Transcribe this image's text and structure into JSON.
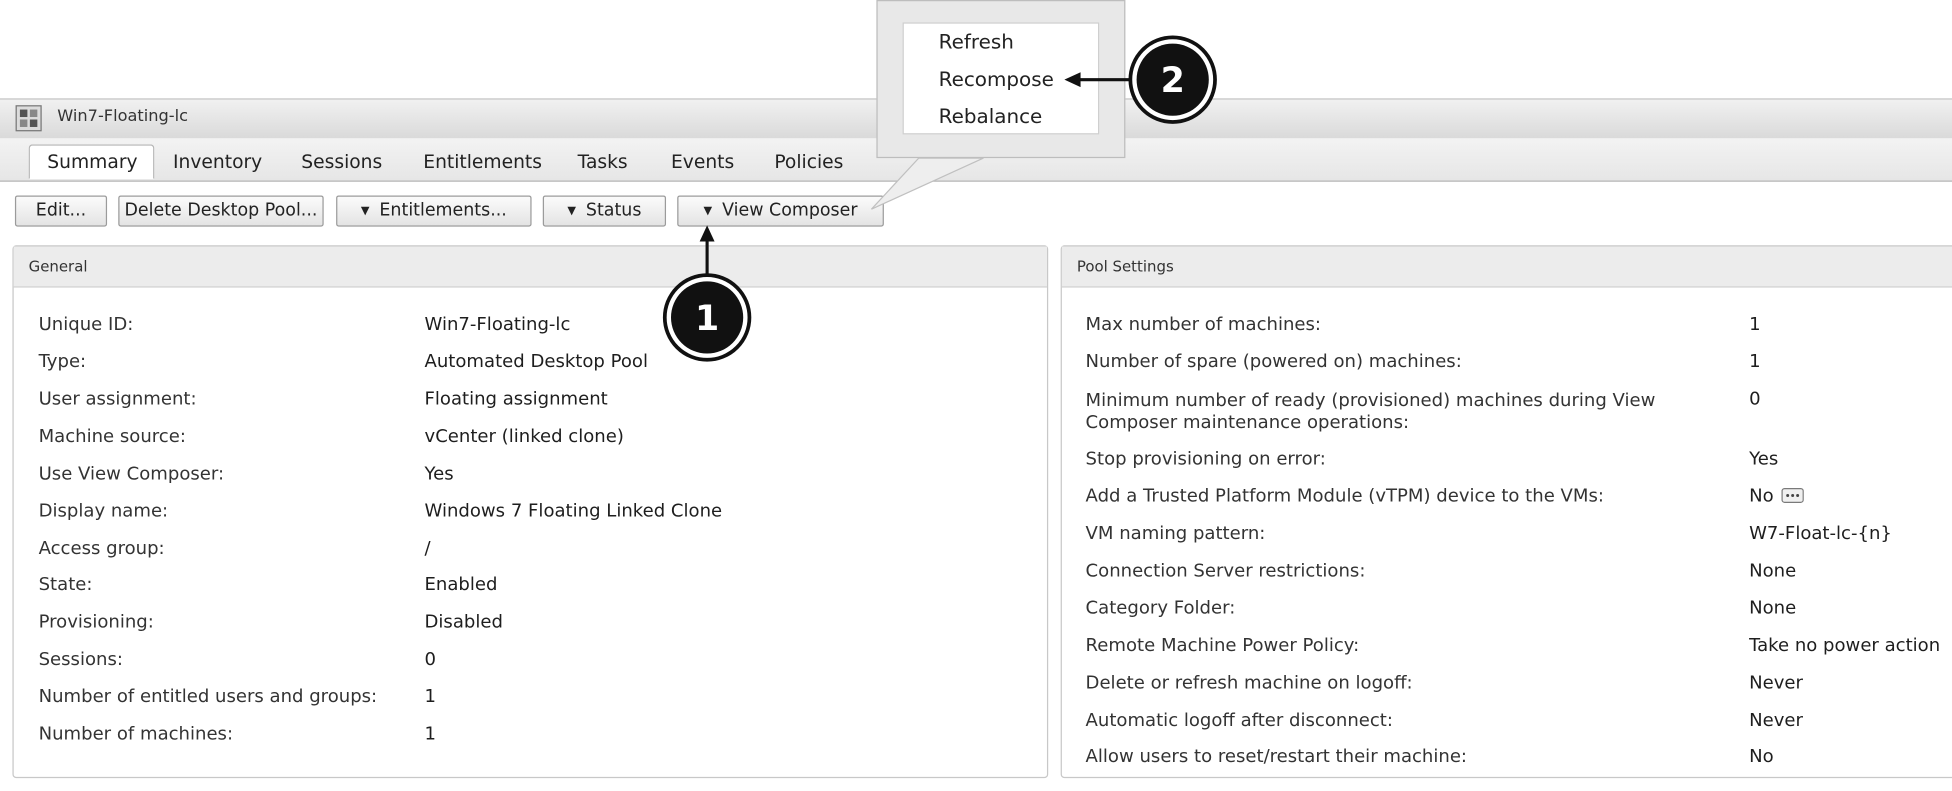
{
  "window": {
    "title": "Win7-Floating-lc"
  },
  "tabs": [
    {
      "label": "Summary",
      "active": true
    },
    {
      "label": "Inventory"
    },
    {
      "label": "Sessions"
    },
    {
      "label": "Entitlements"
    },
    {
      "label": "Tasks"
    },
    {
      "label": "Events"
    },
    {
      "label": "Policies"
    }
  ],
  "toolbar": {
    "edit": "Edit...",
    "delete_pool": "Delete Desktop Pool...",
    "entitlements": "Entitlements...",
    "status": "Status",
    "view_composer": "View Composer"
  },
  "view_composer_menu": {
    "items": [
      "Refresh",
      "Recompose",
      "Rebalance"
    ]
  },
  "callouts": {
    "one": "1",
    "two": "2"
  },
  "general": {
    "header": "General",
    "rows": [
      {
        "label": "Unique ID:",
        "value": "Win7-Floating-lc"
      },
      {
        "label": "Type:",
        "value": "Automated Desktop Pool"
      },
      {
        "label": "User assignment:",
        "value": "Floating assignment"
      },
      {
        "label": "Machine source:",
        "value": "vCenter (linked clone)"
      },
      {
        "label": "Use View Composer:",
        "value": "Yes"
      },
      {
        "label": "Display name:",
        "value": "Windows 7 Floating Linked Clone"
      },
      {
        "label": "Access group:",
        "value": "/"
      },
      {
        "label": "State:",
        "value": "Enabled"
      },
      {
        "label": "Provisioning:",
        "value": "Disabled"
      },
      {
        "label": "Sessions:",
        "value": "0"
      },
      {
        "label": "Number of entitled users and groups:",
        "value": "1"
      },
      {
        "label": "Number of machines:",
        "value": "1"
      }
    ]
  },
  "pool_settings": {
    "header": "Pool Settings",
    "rows": [
      {
        "label": "Max number of machines:",
        "value": "1"
      },
      {
        "label": "Number of spare (powered on) machines:",
        "value": "1"
      },
      {
        "label": "Minimum number of ready (provisioned) machines during View",
        "label2": "Composer maintenance operations:",
        "value": "0"
      },
      {
        "label": "Stop provisioning on error:",
        "value": "Yes"
      },
      {
        "label": "Add a Trusted Platform Module (vTPM) device to the VMs:",
        "value": "No"
      },
      {
        "label": "VM naming pattern:",
        "value": "W7-Float-lc-{n}"
      },
      {
        "label": "Connection Server restrictions:",
        "value": "None"
      },
      {
        "label": "Category Folder:",
        "value": "None"
      },
      {
        "label": "Remote Machine Power Policy:",
        "value": "Take no power action"
      },
      {
        "label": "Delete or refresh machine on logoff:",
        "value": "Never"
      },
      {
        "label": "Automatic logoff after disconnect:",
        "value": "Never"
      },
      {
        "label": "Allow users to reset/restart their machine:",
        "value": "No"
      }
    ]
  }
}
